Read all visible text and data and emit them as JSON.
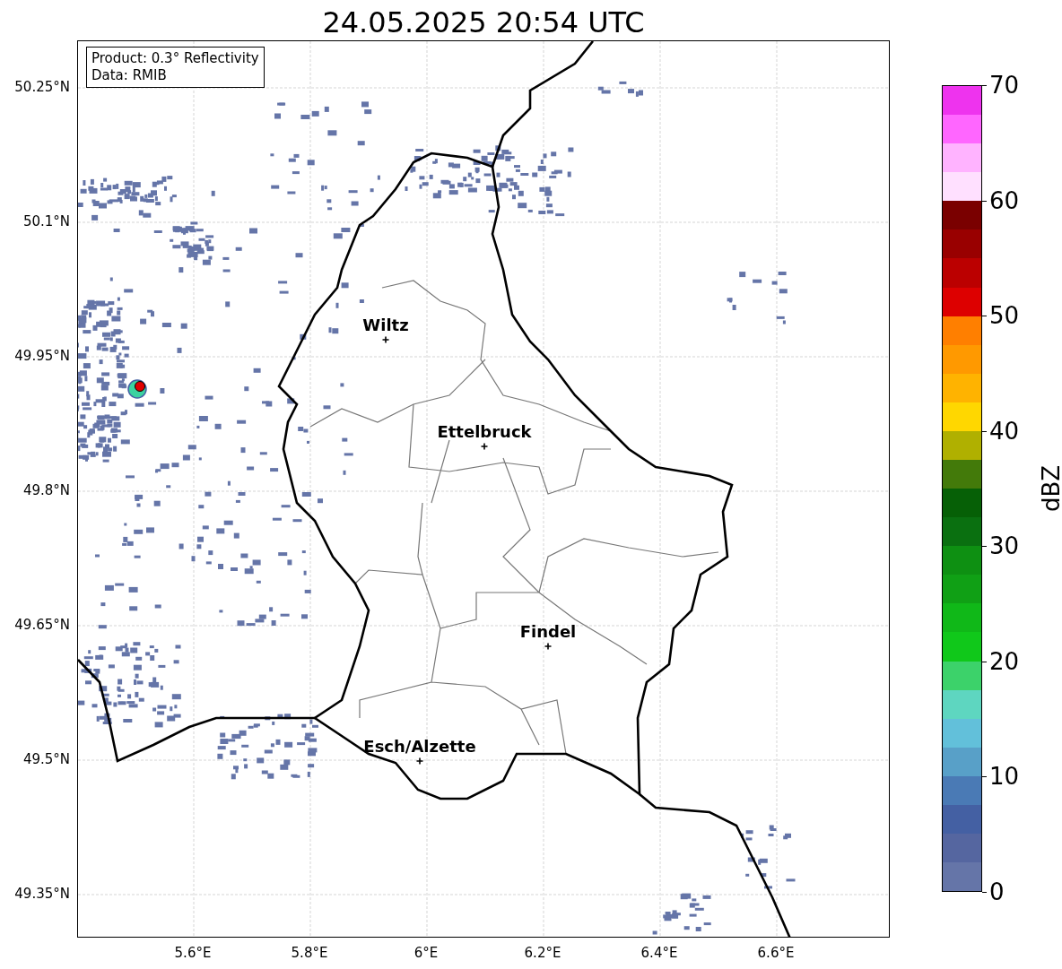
{
  "title": "24.05.2025 20:54 UTC",
  "info_box": [
    "Product: 0.3° Reflectivity",
    "Data: RMIB"
  ],
  "latitude_labels": [
    "50.25°N",
    "50.1°N",
    "49.95°N",
    "49.8°N",
    "49.65°N",
    "49.5°N",
    "49.35°N"
  ],
  "longitude_labels": [
    "5.6°E",
    "5.8°E",
    "6°E",
    "6.2°E",
    "6.4°E",
    "6.6°E"
  ],
  "cities": [
    {
      "name": "Wiltz"
    },
    {
      "name": "Ettelbruck"
    },
    {
      "name": "Findel"
    },
    {
      "name": "Esch/Alzette"
    }
  ],
  "colorbar": {
    "label": "dBZ",
    "ticks": [
      "70",
      "60",
      "50",
      "40",
      "30",
      "20",
      "10",
      "0"
    ],
    "bands": [
      {
        "color": "#ee33ee"
      },
      {
        "color": "#ff66ff"
      },
      {
        "color": "#ffb3ff"
      },
      {
        "color": "#ffe0ff"
      },
      {
        "color": "#7a0000"
      },
      {
        "color": "#990000"
      },
      {
        "color": "#bb0000"
      },
      {
        "color": "#dd0000"
      },
      {
        "color": "#ff7f00"
      },
      {
        "color": "#ff9900"
      },
      {
        "color": "#ffb300"
      },
      {
        "color": "#ffd700"
      },
      {
        "color": "#b0b000"
      },
      {
        "color": "#437a0a"
      },
      {
        "color": "#066006"
      },
      {
        "color": "#0a7010"
      },
      {
        "color": "#0e9012"
      },
      {
        "color": "#10a015"
      },
      {
        "color": "#10b818"
      },
      {
        "color": "#10c81a"
      },
      {
        "color": "#3cd26a"
      },
      {
        "color": "#5ed6c0"
      },
      {
        "color": "#62c0da"
      },
      {
        "color": "#58a0c8"
      },
      {
        "color": "#4a7ab5"
      },
      {
        "color": "#4460a3"
      },
      {
        "color": "#5566a0"
      },
      {
        "color": "#6575a8"
      }
    ]
  }
}
